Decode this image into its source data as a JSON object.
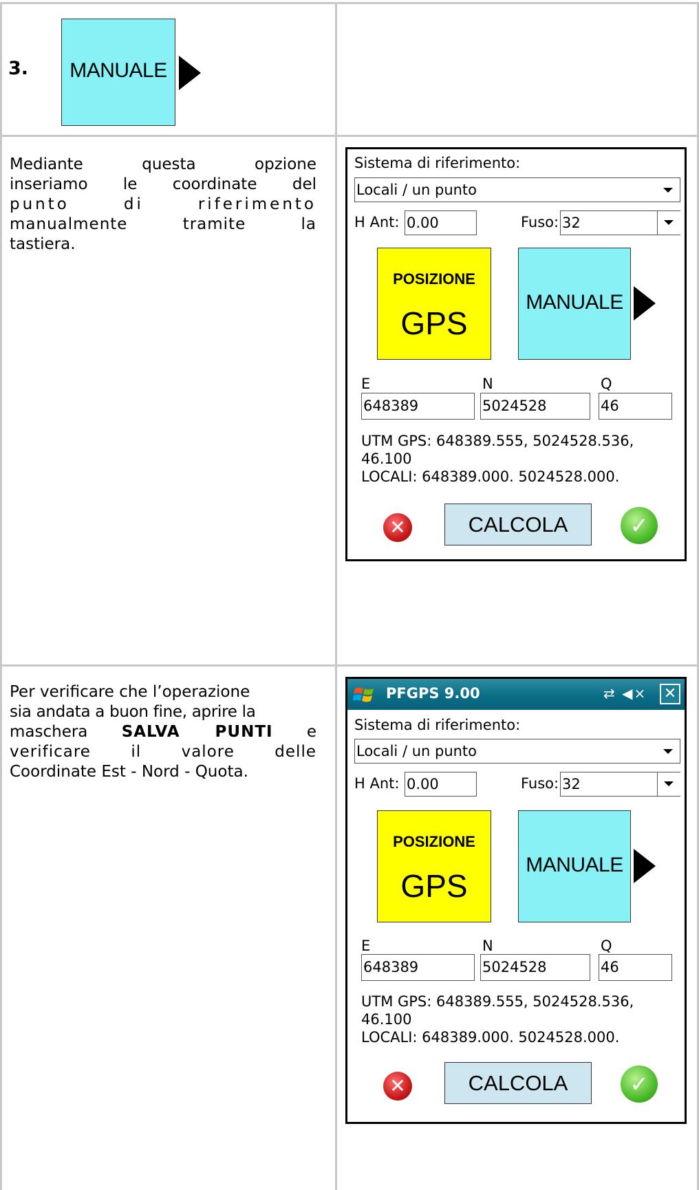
{
  "step": {
    "number": "3.",
    "button_label": "MANUALE"
  },
  "row2": {
    "lines": [
      "Mediante questa opzione",
      "inseriamo le coordinate del",
      "punto di riferimento",
      "manualmente tramite la"
    ],
    "last_line": "tastiera."
  },
  "row3": {
    "line1": "Per verificare che l’operazione",
    "line2": "sia andata a buon fine, aprire la",
    "line3_pre": "maschera",
    "line3_bold": "SALVA PUNTI",
    "line3_post": "e",
    "line4": "verificare il valore delle",
    "line5": "Coordinate Est - Nord - Quota."
  },
  "app": {
    "title": "PFGPS 9.00",
    "status_icons": "⇄ ◀×",
    "close_label": "✕",
    "sistema_label": "Sistema di riferimento:",
    "sistema_value": "Locali / un punto",
    "hant_label": "H Ant:",
    "hant_value": "0.00",
    "fuso_label": "Fuso:",
    "fuso_value": "32",
    "gps_small": "POSIZIONE",
    "gps_big": "GPS",
    "manuale_label": "MANUALE",
    "e_label": "E",
    "n_label": "N",
    "q_label": "Q",
    "e_value": "648389",
    "n_value": "5024528",
    "q_value": "46",
    "utm_line1": "UTM GPS: 648389.555, 5024528.536,",
    "utm_line2": "46.100",
    "locali_line": "LOCALI: 648389.000. 5024528.000.",
    "calcola_label": "CALCOLA",
    "cancel_glyph": "✕",
    "ok_glyph": "✓"
  },
  "colors": {
    "manuale_button": "#87f1f5",
    "gps_button": "#ffff00",
    "calcola_button": "#cde6f0",
    "titlebar": "#0b6d86",
    "grid_lines": "#c8c8c8"
  },
  "icons": [
    "windows-flag-icon",
    "connectivity-icon",
    "volume-mute-icon",
    "close-icon",
    "cancel-icon",
    "confirm-check-icon",
    "play-arrow-icon"
  ]
}
